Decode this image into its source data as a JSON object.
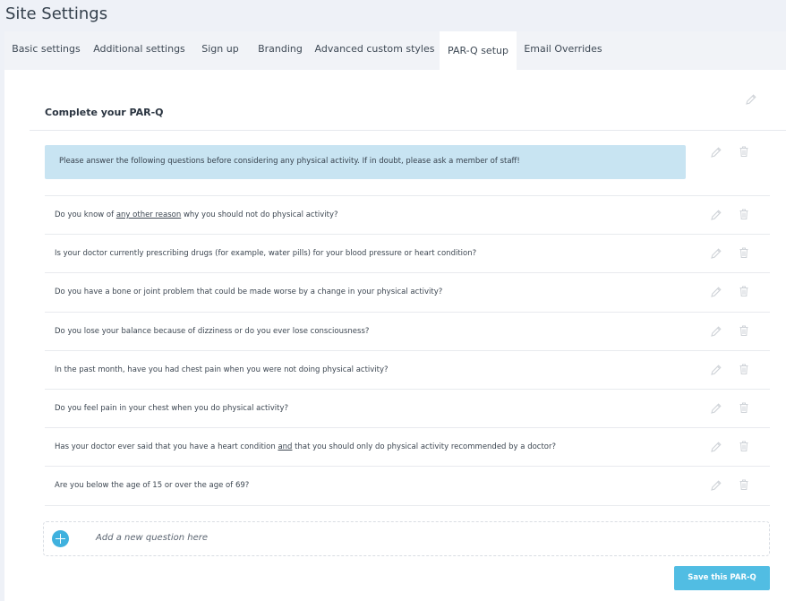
{
  "header": {
    "title": "Site Settings"
  },
  "tabs": [
    {
      "label": "Basic settings"
    },
    {
      "label": "Additional settings"
    },
    {
      "label": "Sign up"
    },
    {
      "label": "Branding"
    },
    {
      "label": "Advanced custom styles"
    },
    {
      "label": "PAR-Q setup",
      "active": true
    },
    {
      "label": "Email Overrides"
    }
  ],
  "form": {
    "title": "Complete your PAR-Q",
    "info": "Please answer the following questions before considering any physical activity. If in doubt, please ask a member of staff!",
    "questions": [
      {
        "before": "Do you know of ",
        "underline": "any other reason",
        "after": " why you should not do physical activity?"
      },
      {
        "before": "Is your doctor currently prescribing drugs (for example, water pills) for your blood pressure or heart condition?",
        "underline": "",
        "after": ""
      },
      {
        "before": "Do you have a bone or joint problem that could be made worse by a change in your physical activity?",
        "underline": "",
        "after": ""
      },
      {
        "before": "Do you lose your balance because of dizziness or do you ever lose consciousness?",
        "underline": "",
        "after": ""
      },
      {
        "before": "In the past month, have you had chest pain when you were not doing physical activity?",
        "underline": "",
        "after": ""
      },
      {
        "before": "Do you feel pain in your chest when you do physical activity?",
        "underline": "",
        "after": ""
      },
      {
        "before": "Has your doctor ever said that you have a heart condition ",
        "underline": "and",
        "after": " that you should only do physical activity recommended by a doctor?"
      },
      {
        "before": "Are you below the age of 15 or over the age of 69?",
        "underline": "",
        "after": ""
      }
    ],
    "add_placeholder": "Add a new question here",
    "save_label": "Save this PAR-Q"
  },
  "icons": {
    "edit": "pencil-icon",
    "delete": "trash-icon",
    "add": "plus-circle-icon"
  },
  "colors": {
    "accent": "#51bde3",
    "info_bg": "#c8e4f2",
    "icon": "#cfd3d8"
  }
}
